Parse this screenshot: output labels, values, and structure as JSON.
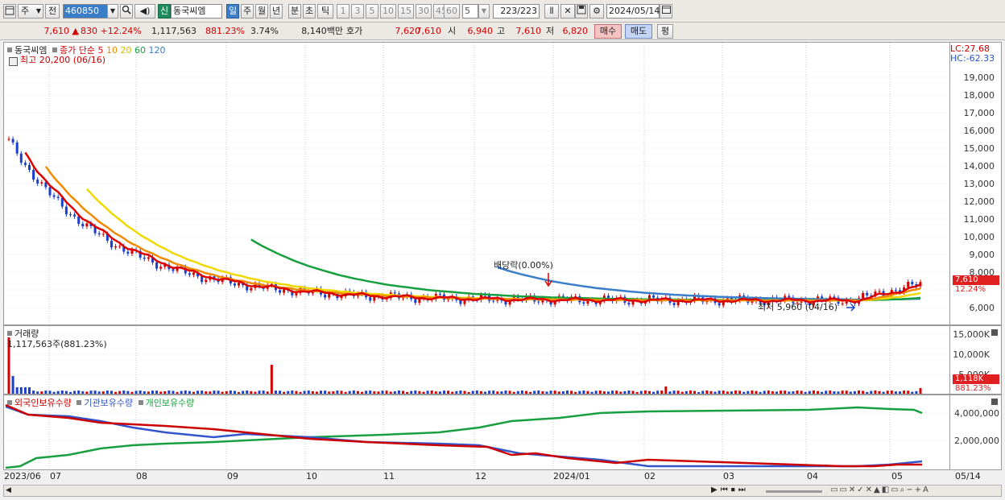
{
  "toolbar": {
    "market": "주",
    "prev": "전",
    "code": "460850",
    "shin": "신",
    "stock_name": "동국씨엠",
    "periods": [
      "일",
      "주",
      "월",
      "년",
      "분",
      "초",
      "틱"
    ],
    "active_period": "일",
    "intervals": [
      "1",
      "3",
      "5",
      "10",
      "15",
      "30",
      "45",
      "60"
    ],
    "interval_value": "5",
    "count": "223",
    "count_total": "/223",
    "date": "2024/05/14"
  },
  "quote": {
    "price": "7,610",
    "arrow": "▲",
    "change": "830",
    "change_pct": "+12.24%",
    "volume": "1,117,563",
    "volume_pct": "881.23%",
    "turnover": "3.74%",
    "amount": "8,140백만",
    "bid_label": "호가",
    "bid": "7,620",
    "ask": "7,610",
    "open_label": "시",
    "open": "6,940",
    "high_label": "고",
    "high": "7,610",
    "low_label": "저",
    "low": "6,820",
    "buy": "매수",
    "sell": "매도",
    "eval": "평"
  },
  "price_panel": {
    "stock_name": "동국씨엠",
    "legend_label": "종가 단순",
    "ma": [
      "5",
      "10",
      "20",
      "60",
      "120"
    ],
    "ma_colors": [
      "#dd0000",
      "#f08a00",
      "#f0d800",
      "#18a040",
      "#3a7dc9"
    ],
    "high_note": "최고 20,200 (06/16)",
    "low_note": "최저 5,960 (04/16)",
    "dividend": "배당락(0.00%)",
    "lc": "LC:27.68",
    "hc": "HC:-62.33",
    "price_tag": "7,610",
    "price_tag_pct": "12.24%",
    "y_ticks": [
      "19,000",
      "18,000",
      "17,000",
      "16,000",
      "15,000",
      "14,000",
      "13,000",
      "12,000",
      "11,000",
      "10,000",
      "9,000",
      "8,000",
      "6,000"
    ]
  },
  "volume_panel": {
    "title": "거래량",
    "value": "1,117,563주(881.23%)",
    "y_ticks": [
      "15,000K",
      "10,000K",
      "5,000K"
    ],
    "tag": "1,118K",
    "tag_pct": "881.23%"
  },
  "holding_panel": {
    "legend": [
      "외국인보유수량",
      "기관보유수량",
      "개인보유수량"
    ],
    "legend_colors": [
      "#cc0000",
      "#3355cc",
      "#18a040"
    ],
    "y_ticks": [
      "4,000,000",
      "2,000,000"
    ]
  },
  "x_axis": [
    "2023/06",
    "07",
    "08",
    "09",
    "10",
    "11",
    "12",
    "2024/01",
    "02",
    "03",
    "04",
    "05",
    "05/14"
  ]
}
